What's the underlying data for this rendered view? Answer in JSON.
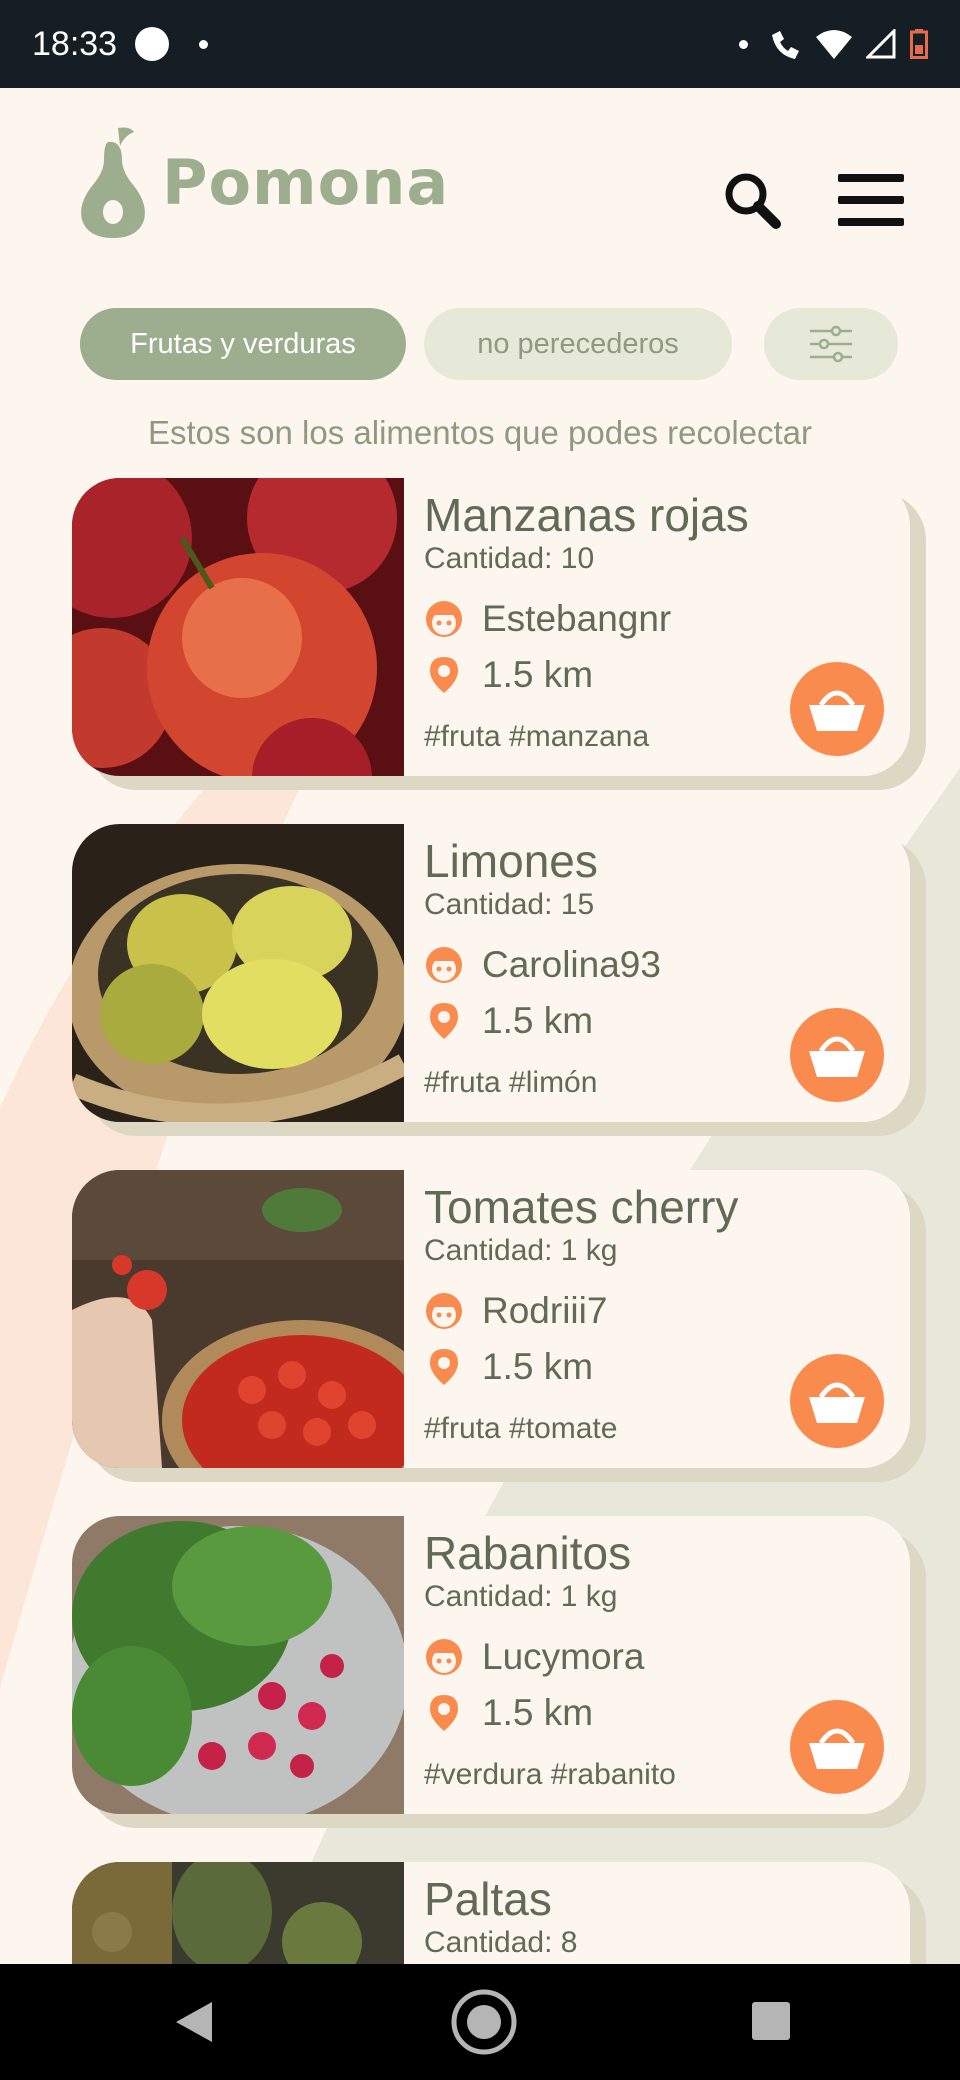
{
  "status_bar": {
    "time": "18:33"
  },
  "header": {
    "app_name": "Pomona",
    "logo_icon": "pear-icon",
    "search_icon": "search-icon",
    "menu_icon": "hamburger-menu-icon"
  },
  "filters": {
    "active_label": "Frutas y verduras",
    "inactive_label": "no perecederos",
    "settings_icon": "sliders-icon"
  },
  "subtitle": "Estos son los alimentos que podes recolectar",
  "colors": {
    "accent_green": "#9cae8d",
    "accent_orange": "#f98b4e",
    "text_dark": "#5f6b55",
    "background": "#fdf6ee"
  },
  "items": [
    {
      "title": "Manzanas rojas",
      "quantity": "Cantidad: 10",
      "user": "Estebangnr",
      "distance": "1.5 km",
      "tags": "#fruta #manzana",
      "image": "red apples photo"
    },
    {
      "title": "Limones",
      "quantity": "Cantidad: 15",
      "user": "Carolina93",
      "distance": "1.5 km",
      "tags": "#fruta #limón",
      "image": "lemons in basket photo"
    },
    {
      "title": "Tomates cherry",
      "quantity": "Cantidad: 1 kg",
      "user": "Rodriii7",
      "distance": "1.5 km",
      "tags": "#fruta #tomate",
      "image": "cherry tomatoes photo"
    },
    {
      "title": "Rabanitos",
      "quantity": "Cantidad: 1 kg",
      "user": "Lucymora",
      "distance": "1.5 km",
      "tags": "#verdura #rabanito",
      "image": "radishes photo"
    },
    {
      "title": "Paltas",
      "quantity": "Cantidad: 8",
      "image": "avocados photo"
    }
  ]
}
